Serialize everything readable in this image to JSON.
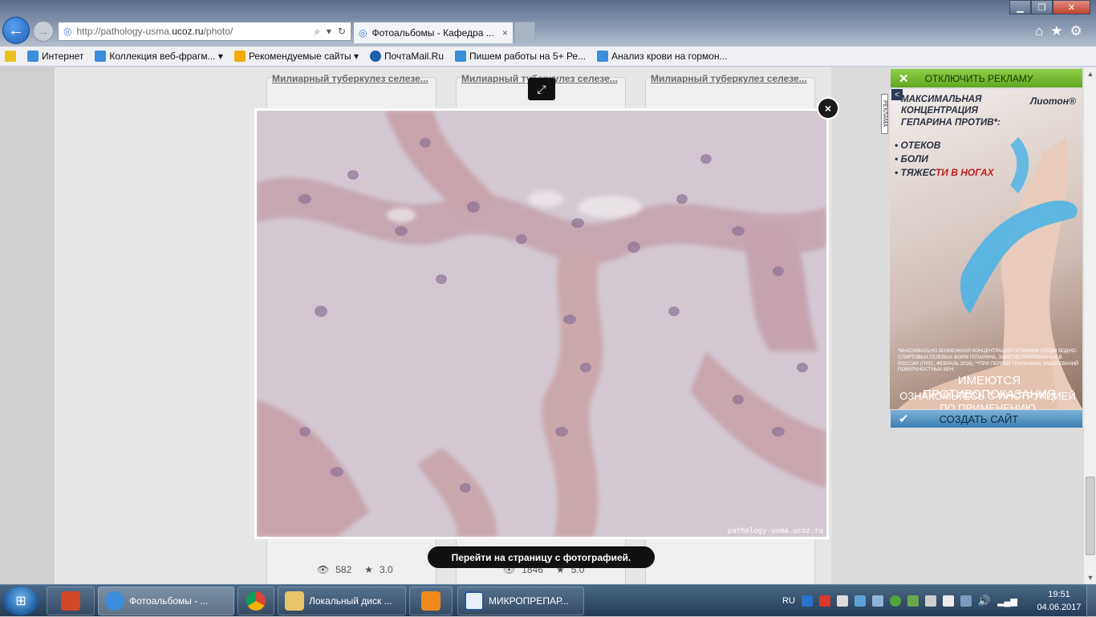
{
  "browser": {
    "url_prefix": "http://pathology-usma.",
    "url_host": "ucoz.ru",
    "url_path": "/photo/",
    "tab_title": "Фотоальбомы - Кафедра ...",
    "tab_close": "×"
  },
  "favorites": [
    {
      "label": "Избранное-star",
      "text": ""
    },
    {
      "label": "Интернет"
    },
    {
      "label": "Коллекция веб-фрагм... ▾"
    },
    {
      "label": "Рекомендуемые сайты ▾"
    },
    {
      "label": "ПочтаMail.Ru"
    },
    {
      "label": "Пишем работы на 5+  Ре..."
    },
    {
      "label": "Анализ крови на гормон..."
    }
  ],
  "page": {
    "card_titles": [
      "Милиарный туберкулез селезе...",
      "Милиарный туберкулез селезе...",
      "Милиарный туберкулез селезе..."
    ],
    "card1_views": "582",
    "card1_rating": "3.0",
    "card2_views": "1846",
    "card2_rating": "5.0",
    "goto_label": "Перейти на страницу с фотографией.",
    "watermark": "pathology-usma.ucoz.ru",
    "close_symbol": "×",
    "expand_symbol": "⤢"
  },
  "ad": {
    "disable_label": "ОТКЛЮЧИТЬ РЕКЛАМУ",
    "headline": "МАКСИМАЛЬНАЯ КОНЦЕНТРАЦИЯ ГЕПАРИНА ПРОТИВ*:",
    "brand": "Лиотон®",
    "items": [
      "ОТЕКОВ",
      "БОЛИ",
      "ТЯЖЕС"
    ],
    "item3_red": "ТИ В НОГАХ",
    "small_print": "*МАКСИМАЛЬНО ВОЗМОЖНАЯ КОНЦЕНТРАЦИЯ ГЕПАРИНА СРЕДИ ВОДНО-СПИРТОВЫХ ГЕЛЕВЫХ ФОРМ ГЕПАРИНА, ЗАРЕГИСТРИРОВАННЫХ В РОССИИ (ГРЛС, ФЕВРАЛЬ 2016). **ПРИ ПЕРВЫХ ПРИЗНАКАХ ЗАБОЛЕВАНИЙ ПОВЕРХНОСТНЫХ ВЕН",
    "contra": "ИМЕЮТСЯ ПРОТИВОПОКАЗАНИЯ",
    "instr": "ОЗНАКОМЬТЕСЬ С ИНСТРУКЦИЕЙ ПО ПРИМЕНЕНИЮ",
    "create_label": "СОЗДАТЬ САЙТ",
    "marker": "РЕКЛАМА"
  },
  "taskbar": {
    "items": [
      "",
      "Фотоальбомы - ...",
      "",
      "Локальный диск ...",
      "",
      "МИКРОПРЕПАР..."
    ],
    "lang": "RU",
    "time": "19:51",
    "date": "04.06.2017"
  },
  "colors": {
    "ad_green": "#6cb52d",
    "ad_blue": "#4a8ac0",
    "overlay_dark": "#111111"
  }
}
